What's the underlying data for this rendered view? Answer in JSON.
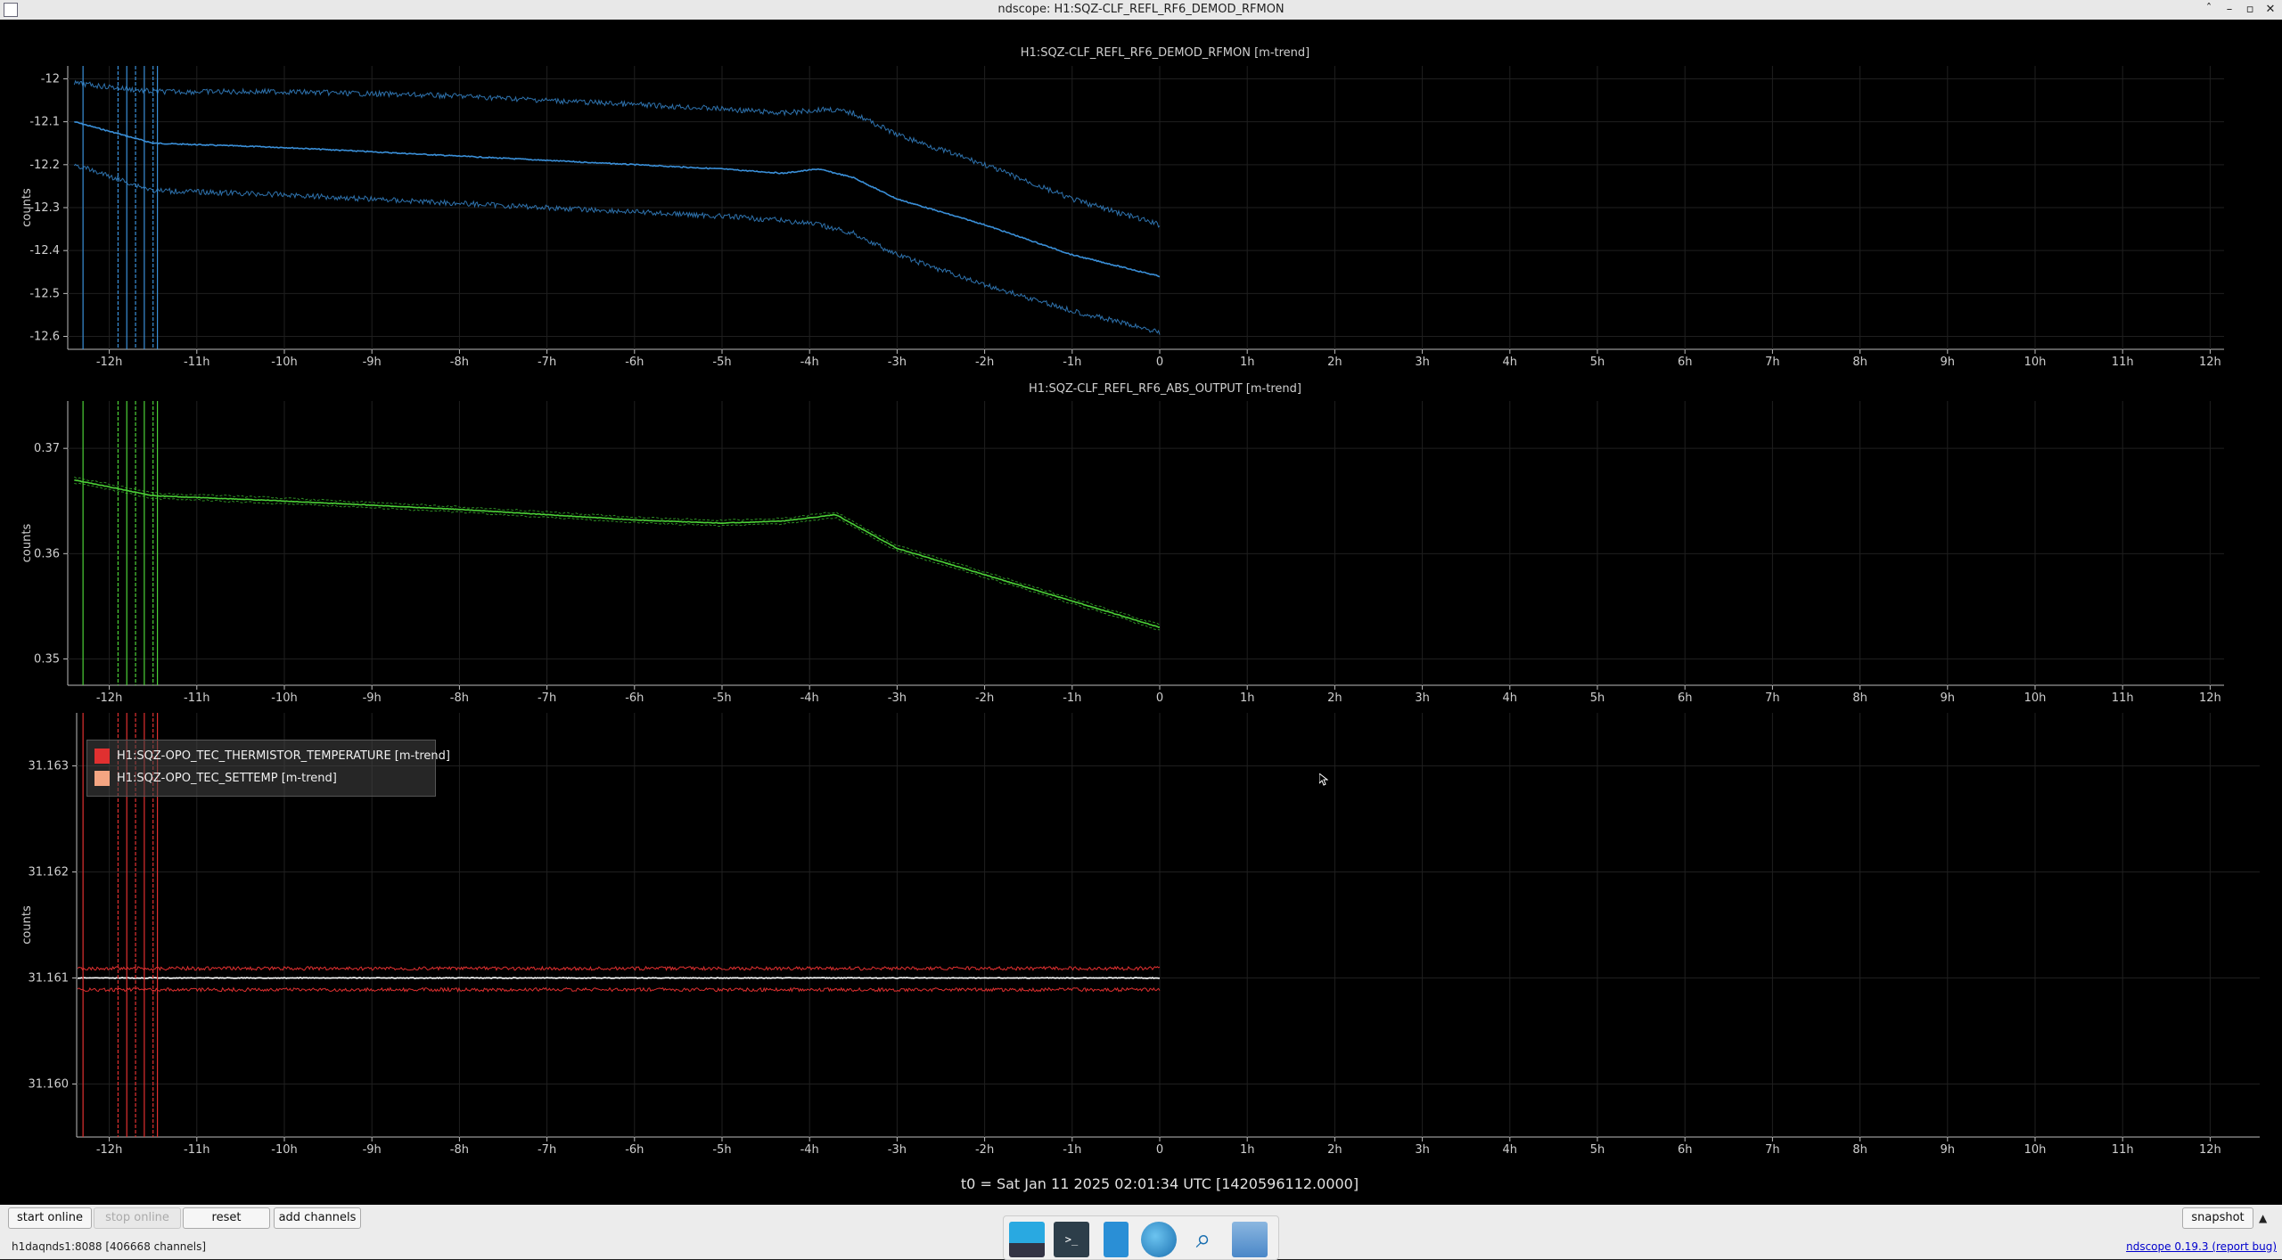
{
  "window": {
    "title": "ndscope: H1:SQZ-CLF_REFL_RF6_DEMOD_RFMON",
    "controls": [
      "ˆ",
      "–",
      "▫",
      "✕"
    ]
  },
  "plots": [
    {
      "title": "H1:SQZ-CLF_REFL_RF6_DEMOD_RFMON [m-trend]",
      "ylabel": "counts",
      "yticks": [
        "-12",
        "-12.1",
        "-12.2",
        "-12.3",
        "-12.4",
        "-12.5",
        "-12.6"
      ],
      "color": "#3a8fd8"
    },
    {
      "title": "H1:SQZ-CLF_REFL_RF6_ABS_OUTPUT [m-trend]",
      "ylabel": "counts",
      "yticks": [
        "0.37",
        "0.36",
        "0.35"
      ],
      "color": "#4cd137"
    },
    {
      "title": "",
      "ylabel": "counts",
      "yticks": [
        "31.163",
        "31.162",
        "31.161",
        "31.160"
      ],
      "color": "#e03030"
    }
  ],
  "xticks": [
    "-12h",
    "-11h",
    "-10h",
    "-9h",
    "-8h",
    "-7h",
    "-6h",
    "-5h",
    "-4h",
    "-3h",
    "-2h",
    "-1h",
    "0",
    "1h",
    "2h",
    "3h",
    "4h",
    "5h",
    "6h",
    "7h",
    "8h",
    "9h",
    "10h",
    "11h",
    "12h"
  ],
  "legend": {
    "items": [
      {
        "label": "H1:SQZ-OPO_TEC_THERMISTOR_TEMPERATURE [m-trend]",
        "color": "#e03030"
      },
      {
        "label": "H1:SQZ-OPO_TEC_SETTEMP [m-trend]",
        "color": "#f4a582"
      }
    ]
  },
  "t0": "t0 = Sat Jan 11 2025 02:01:34 UTC [1420596112.0000]",
  "toolbar": {
    "start_online": "start online",
    "stop_online": "stop online",
    "reset": "reset",
    "add_channels": "add channels",
    "snapshot": "snapshot"
  },
  "status": {
    "server": "h1daqnds1:8088  [406668 channels]"
  },
  "version": {
    "link": "ndscope 0.19.3",
    "report": "(report bug)"
  },
  "dock": {
    "icons": [
      "desktop-icon",
      "terminal-icon",
      "text-editor-icon",
      "browser-icon",
      "search-icon",
      "files-icon"
    ]
  },
  "chart_data": [
    {
      "type": "line",
      "title": "H1:SQZ-CLF_REFL_RF6_DEMOD_RFMON [m-trend]",
      "ylabel": "counts",
      "xlabel": "",
      "xlim": [
        -12.4,
        12.2
      ],
      "ylim": [
        -12.63,
        -11.97
      ],
      "series": [
        {
          "x": [
            -12.4,
            -11.5,
            -10,
            -8,
            -6,
            -5,
            -4.3,
            -3.9,
            -3.5,
            -3,
            -2,
            -1,
            0
          ],
          "values": [
            -12.1,
            -12.15,
            -12.16,
            -12.18,
            -12.2,
            -12.21,
            -12.22,
            -12.21,
            -12.23,
            -12.28,
            -12.34,
            -12.41,
            -12.46
          ]
        },
        {
          "x": [
            -12.4,
            -11.5,
            -10,
            -8,
            -6,
            -5,
            -4.3,
            -3.8,
            -3.5,
            -3,
            -2,
            -1,
            0
          ],
          "values": [
            -12.01,
            -12.03,
            -12.03,
            -12.04,
            -12.06,
            -12.07,
            -12.08,
            -12.07,
            -12.08,
            -12.13,
            -12.2,
            -12.28,
            -12.34
          ]
        },
        {
          "x": [
            -12.4,
            -11.5,
            -10,
            -8,
            -6,
            -5,
            -4.3,
            -3.9,
            -3.5,
            -3,
            -2,
            -1,
            0
          ],
          "values": [
            -12.2,
            -12.26,
            -12.27,
            -12.29,
            -12.31,
            -12.32,
            -12.33,
            -12.34,
            -12.36,
            -12.41,
            -12.48,
            -12.54,
            -12.59
          ]
        }
      ]
    },
    {
      "type": "line",
      "title": "H1:SQZ-CLF_REFL_RF6_ABS_OUTPUT [m-trend]",
      "ylabel": "counts",
      "xlabel": "",
      "xlim": [
        -12.4,
        12.2
      ],
      "ylim": [
        0.3475,
        0.3745
      ],
      "series": [
        {
          "x": [
            -12.4,
            -11.5,
            -10,
            -8,
            -6,
            -5,
            -4.3,
            -3.7,
            -3,
            -2,
            -1,
            0
          ],
          "values": [
            0.367,
            0.3655,
            0.365,
            0.3642,
            0.3632,
            0.3629,
            0.3631,
            0.3637,
            0.3605,
            0.358,
            0.3555,
            0.353
          ]
        }
      ]
    },
    {
      "type": "line",
      "title": "",
      "ylabel": "counts",
      "xlabel": "",
      "xlim": [
        -12.4,
        12.2
      ],
      "ylim": [
        31.1595,
        31.1635
      ],
      "series": [
        {
          "x": [
            -12.4,
            0
          ],
          "values": [
            31.161,
            31.161
          ]
        },
        {
          "x": [
            -12.4,
            0
          ],
          "values": [
            31.16109,
            31.16109
          ]
        },
        {
          "x": [
            -12.4,
            0
          ],
          "values": [
            31.16089,
            31.16089
          ]
        }
      ]
    }
  ]
}
